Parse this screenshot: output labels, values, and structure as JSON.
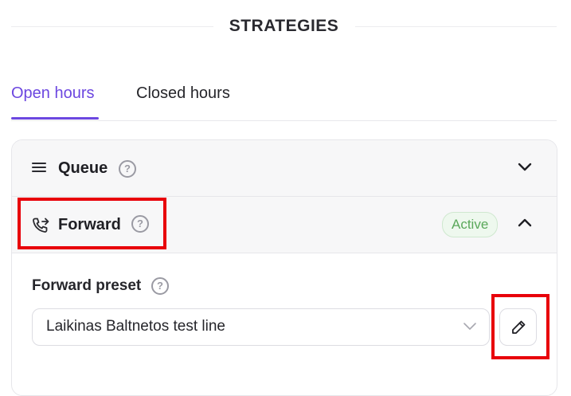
{
  "section_title": "STRATEGIES",
  "tabs": [
    {
      "label": "Open hours",
      "active": true
    },
    {
      "label": "Closed hours",
      "active": false
    }
  ],
  "strategies": {
    "queue": {
      "label": "Queue",
      "icon": "menu-lines-icon",
      "expanded": false
    },
    "forward": {
      "label": "Forward",
      "icon": "phone-forward-icon",
      "status": "Active",
      "expanded": true
    }
  },
  "forward_preset": {
    "label": "Forward preset",
    "selected_value": "Laikinas Baltnetos test line"
  },
  "help_glyph": "?",
  "colors": {
    "accent": "#6c47e0",
    "active_badge_text": "#5aa85a",
    "highlight": "#e8000a"
  }
}
